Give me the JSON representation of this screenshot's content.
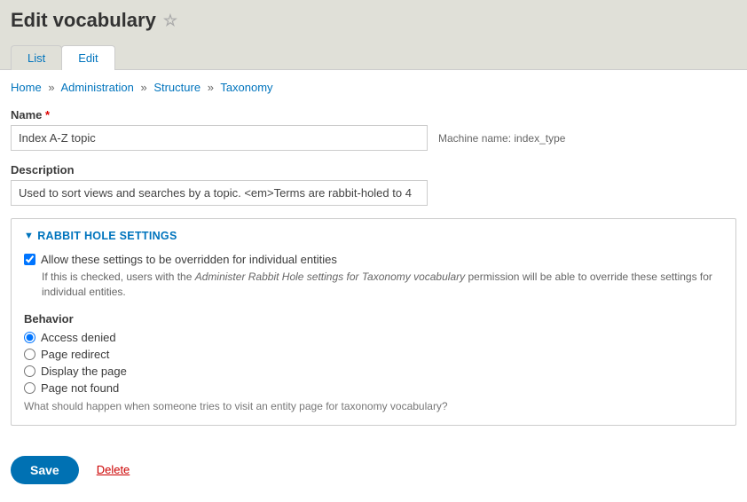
{
  "page_title": "Edit vocabulary",
  "tabs": {
    "list": "List",
    "edit": "Edit"
  },
  "breadcrumb": {
    "items": [
      "Home",
      "Administration",
      "Structure",
      "Taxonomy"
    ],
    "sep": "»"
  },
  "form": {
    "name_label": "Name",
    "name_value": "Index A-Z topic",
    "machine_name_label": "Machine name:",
    "machine_name_value": "index_type",
    "description_label": "Description",
    "description_value": "Used to sort views and searches by a topic. <em>Terms are rabbit-holed to 4"
  },
  "rabbit_hole": {
    "legend": "RABBIT HOLE SETTINGS",
    "override_label": "Allow these settings to be overridden for individual entities",
    "override_help_pre": "If this is checked, users with the ",
    "override_help_em": "Administer Rabbit Hole settings for Taxonomy vocabulary",
    "override_help_post": " permission will be able to override these settings for individual entities.",
    "behavior_label": "Behavior",
    "options": {
      "access_denied": "Access denied",
      "page_redirect": "Page redirect",
      "display_page": "Display the page",
      "page_not_found": "Page not found"
    },
    "behavior_help": "What should happen when someone tries to visit an entity page for taxonomy vocabulary?"
  },
  "actions": {
    "save": "Save",
    "delete": "Delete"
  }
}
